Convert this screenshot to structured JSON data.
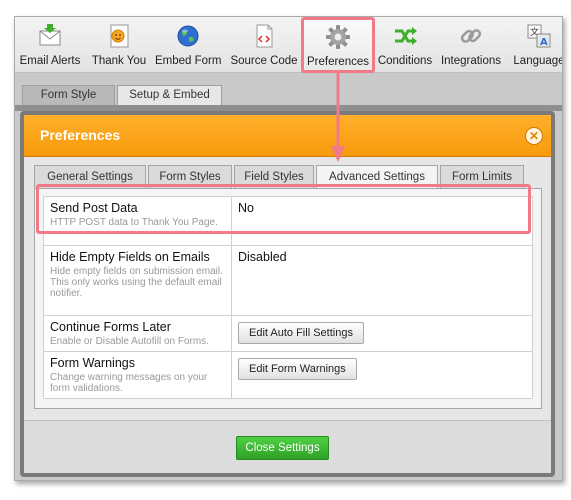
{
  "toolbar": {
    "items": [
      {
        "label": "Email Alerts",
        "icon": "email-alerts-icon"
      },
      {
        "label": "Thank You",
        "icon": "thank-you-icon"
      },
      {
        "label": "Embed Form",
        "icon": "globe-icon"
      },
      {
        "label": "Source Code",
        "icon": "source-code-icon"
      },
      {
        "label": "Preferences",
        "icon": "gear-icon"
      },
      {
        "label": "Conditions",
        "icon": "conditions-icon"
      },
      {
        "label": "Integrations",
        "icon": "link-icon"
      },
      {
        "label": "Language",
        "icon": "language-icon"
      }
    ],
    "active": "Preferences"
  },
  "subtabs": [
    "Form Style",
    "Setup & Embed"
  ],
  "dialog": {
    "title": "Preferences",
    "close_symbol": "✕",
    "tabs": [
      "General Settings",
      "Form Styles",
      "Field Styles",
      "Advanced Settings",
      "Form Limits"
    ],
    "selected_tab": "Advanced Settings",
    "settings": [
      {
        "title": "Send Post Data",
        "desc": "HTTP POST data to Thank You Page.",
        "value": "No"
      },
      {
        "title": "Hide Empty Fields on Emails",
        "desc": "Hide empty fields on submission email. This only works using the default email notifier.",
        "value": "Disabled"
      },
      {
        "title": "Continue Forms Later",
        "desc": "Enable or Disable Autofill on Forms.",
        "button": "Edit Auto Fill Settings"
      },
      {
        "title": "Form Warnings",
        "desc": "Change warning messages on your form validations.",
        "button": "Edit Form Warnings"
      }
    ],
    "close_button": "Close Settings"
  },
  "colors": {
    "accent_orange": "#f79b0c",
    "highlight": "#f07a88",
    "green_button": "#2fa127"
  }
}
